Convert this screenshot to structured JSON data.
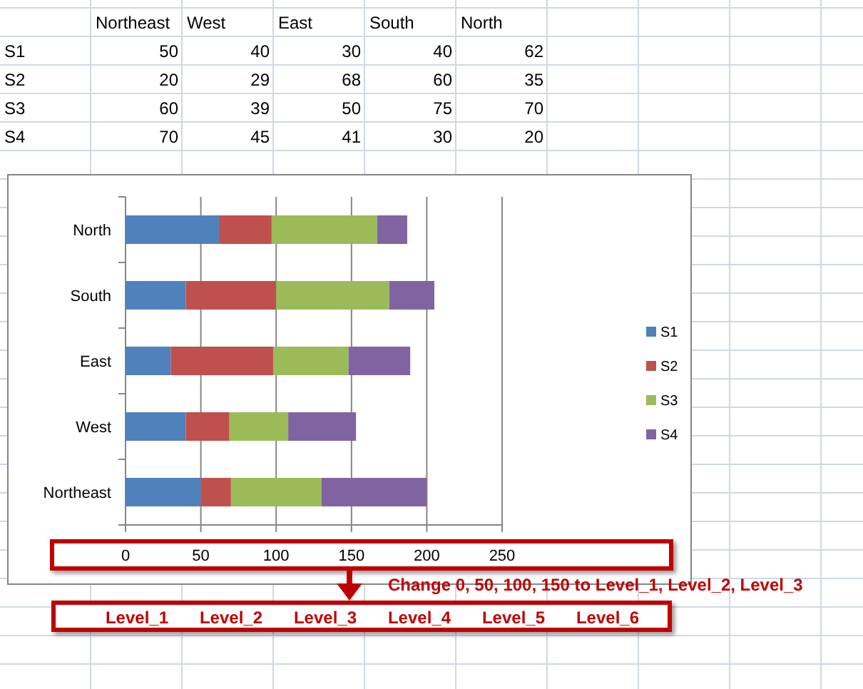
{
  "table": {
    "columns": [
      "Northeast",
      "West",
      "East",
      "South",
      "North"
    ],
    "rows": [
      {
        "name": "S1",
        "values": [
          "50",
          "40",
          "30",
          "40",
          "62"
        ]
      },
      {
        "name": "S2",
        "values": [
          "20",
          "29",
          "68",
          "60",
          "35"
        ]
      },
      {
        "name": "S3",
        "values": [
          "60",
          "39",
          "50",
          "75",
          "70"
        ]
      },
      {
        "name": "S4",
        "values": [
          "70",
          "45",
          "41",
          "30",
          "20"
        ]
      }
    ]
  },
  "chart": {
    "chart_data": {
      "type": "bar",
      "orientation": "horizontal",
      "stacked": true,
      "categories": [
        "North",
        "South",
        "East",
        "West",
        "Northeast"
      ],
      "series": [
        {
          "name": "S1",
          "color": "#4f81bd",
          "values": [
            62,
            40,
            30,
            40,
            50
          ]
        },
        {
          "name": "S2",
          "color": "#c0504d",
          "values": [
            35,
            60,
            68,
            29,
            20
          ]
        },
        {
          "name": "S3",
          "color": "#9bbb59",
          "values": [
            70,
            75,
            50,
            39,
            60
          ]
        },
        {
          "name": "S4",
          "color": "#8064a2",
          "values": [
            20,
            30,
            41,
            45,
            70
          ]
        }
      ],
      "xlim": [
        0,
        250
      ],
      "grid": true,
      "legend": "right",
      "xticks": [
        0,
        50,
        100,
        150,
        200,
        250
      ]
    }
  },
  "annotation": "Change 0, 50, 100, 150 to Level_1, Level_2, Level_3",
  "level_labels": [
    "Level_1",
    "Level_2",
    "Level_3",
    "Level_4",
    "Level_5",
    "Level_6"
  ]
}
